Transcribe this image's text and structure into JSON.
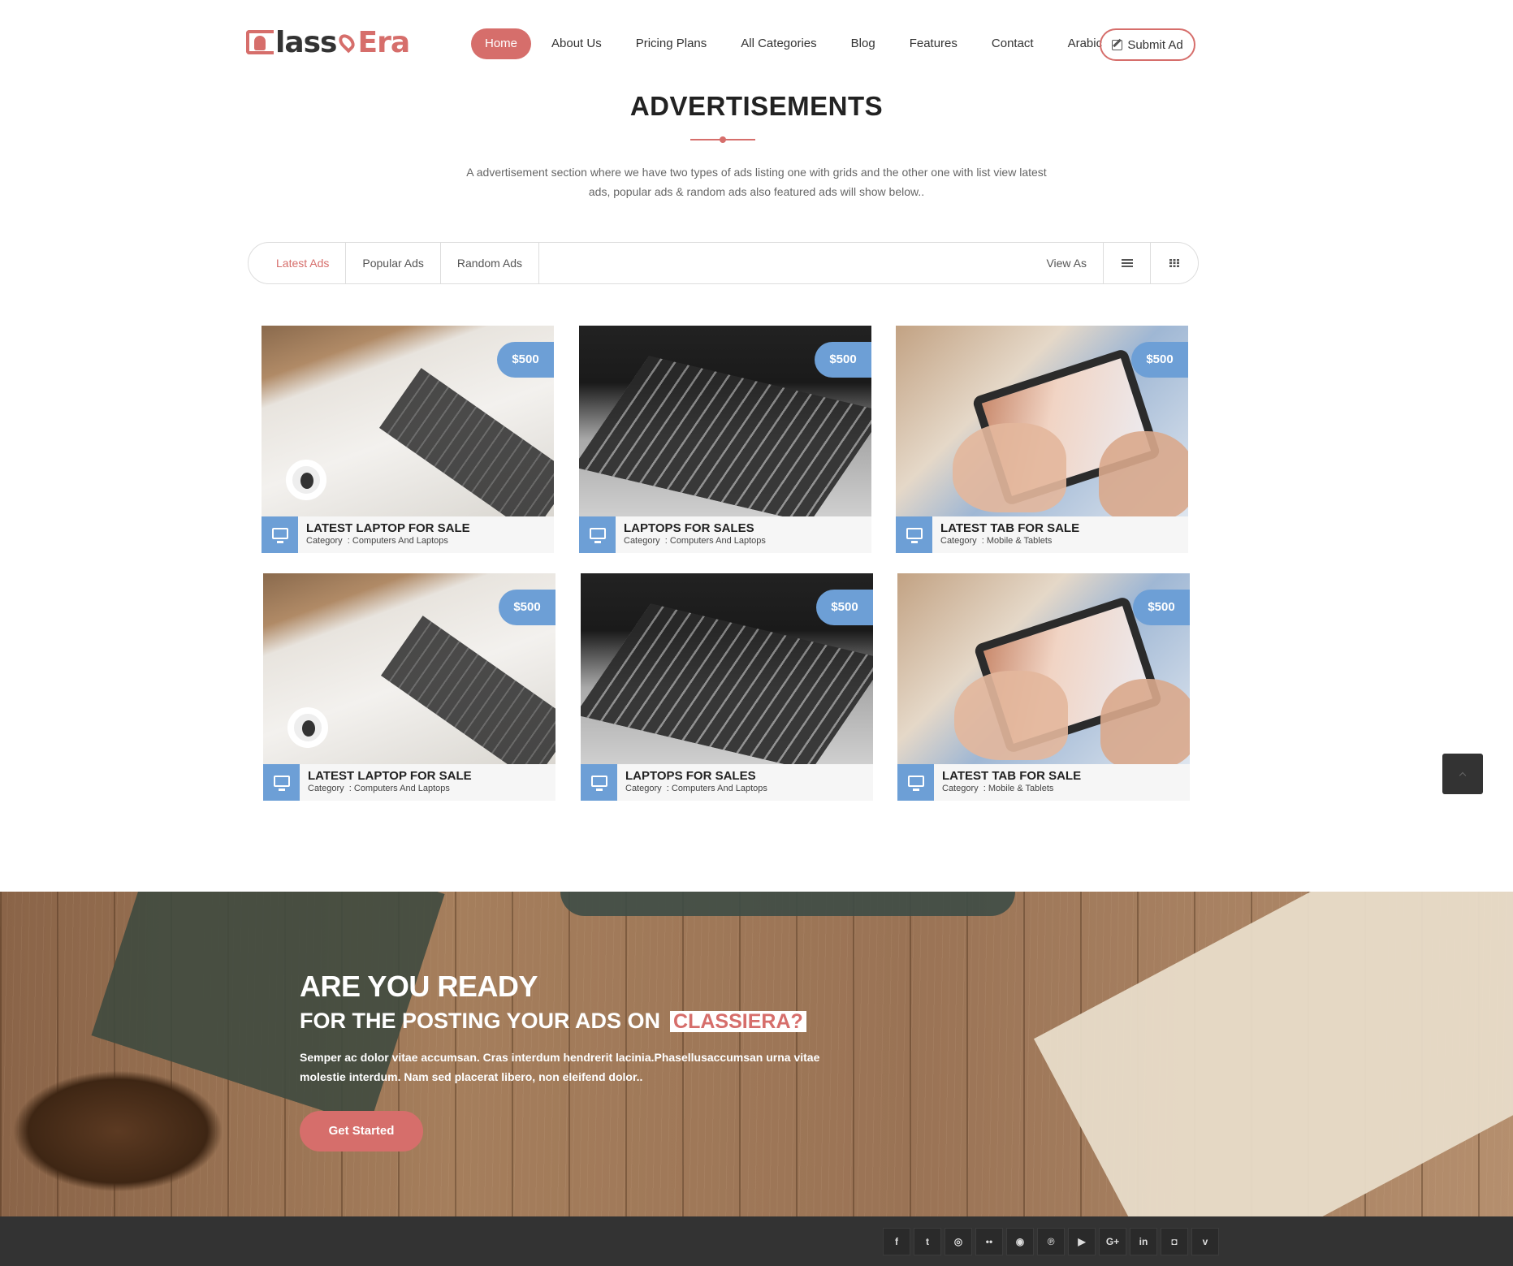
{
  "header": {
    "logo_main": "lass",
    "logo_accent": "Era",
    "nav": [
      "Home",
      "About Us",
      "Pricing Plans",
      "All Categories",
      "Blog",
      "Features",
      "Contact",
      "Arabic"
    ],
    "submit_label": "Submit Ad",
    "accent_color": "#d66e6b"
  },
  "section": {
    "title": "ADVERTISEMENTS",
    "description": "A advertisement section where we have two types of ads listing one with grids and the other one with list view latest ads, popular ads & random ads also featured ads will show below.."
  },
  "tabs": {
    "items": [
      "Latest Ads",
      "Popular Ads",
      "Random Ads"
    ],
    "view_as": "View As",
    "list_icon": "list-icon",
    "grid_icon": "grid-icon"
  },
  "ads": [
    {
      "price": "$500",
      "title": "LATEST LAPTOP FOR SALE",
      "category_label": "Category",
      "category": "Computers And Laptops",
      "image": "laptop-with-headphones"
    },
    {
      "price": "$500",
      "title": "LAPTOPS FOR SALES",
      "category_label": "Category",
      "category": "Computers And Laptops",
      "image": "laptop-keyboard"
    },
    {
      "price": "$500",
      "title": "LATEST TAB FOR SALE",
      "category_label": "Category",
      "category": "Mobile & Tablets",
      "image": "hands-on-tablet"
    },
    {
      "price": "$500",
      "title": "LATEST LAPTOP FOR SALE",
      "category_label": "Category",
      "category": "Computers And Laptops",
      "image": "laptop-with-headphones"
    },
    {
      "price": "$500",
      "title": "LAPTOPS FOR SALES",
      "category_label": "Category",
      "category": "Computers And Laptops",
      "image": "laptop-keyboard"
    },
    {
      "price": "$500",
      "title": "LATEST TAB FOR SALE",
      "category_label": "Category",
      "category": "Mobile & Tablets",
      "image": "hands-on-tablet"
    }
  ],
  "price_color": "#6d9fd6",
  "cta": {
    "line1": "ARE YOU READY",
    "line2": "FOR THE POSTING YOUR ADS ON",
    "brand": "CLASSIERA?",
    "text": "Semper ac dolor vitae accumsan. Cras interdum hendrerit lacinia.Phasellusaccumsan urna vitae molestie interdum. Nam sed placerat libero, non eleifend dolor..",
    "button": "Get Started"
  },
  "footer": {
    "socials": [
      {
        "icon": "facebook-icon",
        "glyph": "f"
      },
      {
        "icon": "twitter-icon",
        "glyph": "t"
      },
      {
        "icon": "dribbble-icon",
        "glyph": "◎"
      },
      {
        "icon": "flickr-icon",
        "glyph": "••"
      },
      {
        "icon": "github-icon",
        "glyph": "◉"
      },
      {
        "icon": "pinterest-icon",
        "glyph": "℗"
      },
      {
        "icon": "youtube-icon",
        "glyph": "▶"
      },
      {
        "icon": "google-plus-icon",
        "glyph": "G+"
      },
      {
        "icon": "linkedin-icon",
        "glyph": "in"
      },
      {
        "icon": "instagram-icon",
        "glyph": "◘"
      },
      {
        "icon": "vimeo-icon",
        "glyph": "v"
      }
    ]
  }
}
